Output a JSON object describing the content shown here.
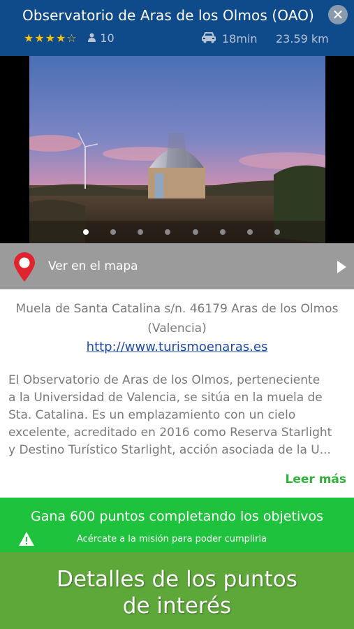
{
  "header": {
    "title": "Observatorio de Aras de los Olmos (OAO)",
    "stars": "★★★★☆",
    "rating": 4.5,
    "review_count": "10",
    "travel_time": "18min",
    "distance": "23.59 km",
    "close_icon": "close-icon",
    "user_icon": "user-icon",
    "car_icon": "car-icon"
  },
  "gallery": {
    "image_count": 8,
    "active_index": 0
  },
  "map_link": {
    "label": "Ver en el mapa",
    "pin_icon": "map-pin-icon",
    "arrow_icon": "chevron-right-icon"
  },
  "details": {
    "address_line1": "Muela de Santa Catalina s/n. 46179 Aras de los Olmos",
    "address_line2": "(Valencia)",
    "website": "http://www.turismoenaras.es",
    "description_lines": [
      "El Observatorio de Aras de los Olmos, perteneciente",
      "a la Universidad de Valencia, se sitúa en la muela de",
      "Sta. Catalina. Es un emplazamiento con un cielo",
      "excelente, acreditado en 2016 como Reserva Starlight",
      "y Destino Turístico Starlight, acción asociada de la U..."
    ],
    "read_more": "Leer más"
  },
  "mission": {
    "title": "Gana 600 puntos completando los objetivos",
    "subtitle": "Acércate a la misión para poder cumplirla",
    "warning_icon": "warning-icon"
  },
  "banner": {
    "line1": "Detalles de los puntos",
    "line2": "de interés"
  },
  "colors": {
    "header_bg": "#0f4a8a",
    "map_row_bg": "#9b9b9b",
    "pin": "#e0242f",
    "link": "#1f4aa8",
    "read_more": "#2fb23a",
    "mission_bg": "#1ec23c",
    "banner_bg": "#5ea83a"
  }
}
